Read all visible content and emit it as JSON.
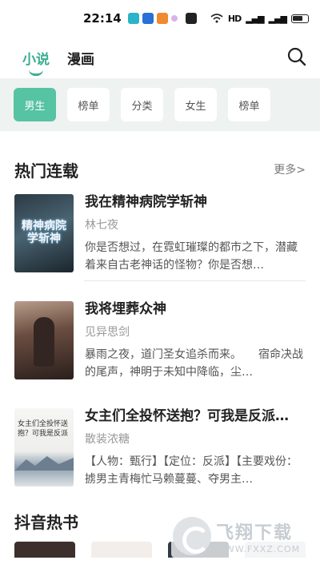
{
  "status_bar": {
    "time": "22:14"
  },
  "nav": {
    "tabs": [
      {
        "label": "小说",
        "active": true
      },
      {
        "label": "漫画",
        "active": false
      }
    ],
    "search_icon": "search-icon"
  },
  "filters": [
    "男生",
    "榜单",
    "分类",
    "女生",
    "榜单"
  ],
  "section1": {
    "title": "热门连载",
    "more": "更多>"
  },
  "books": [
    {
      "title": "我在精神病院学斩神",
      "author": "林七夜",
      "desc": "你是否想过，在霓虹璀璨的都市之下，潜藏着来自古老神话的怪物？你是否想…",
      "cover_text": "精神病院学斩神"
    },
    {
      "title": "我将埋葬众神",
      "author": "见异思剑",
      "desc": "暴雨之夜，道门圣女追杀而来。　　宿命决战的尾声，神明于未知中降临，尘…"
    },
    {
      "title": "女主们全投怀送抱？可我是反派…",
      "author": "散装浓糖",
      "desc": "【人物：甄行】【定位：反派】【主要戏份：掳男主青梅忙马赖蔓蔓、夺男主…",
      "cover_text": "女主们全投怀送抱？可我是反派"
    }
  ],
  "section2": {
    "title": "抖音热书"
  },
  "watermark": {
    "main": "飞翔下载",
    "url": "WWW.FXXZ.COM"
  },
  "colors": {
    "accent": "#3aae92",
    "chip_active": "#56c3a2",
    "filter_bg": "#eef2f1"
  }
}
